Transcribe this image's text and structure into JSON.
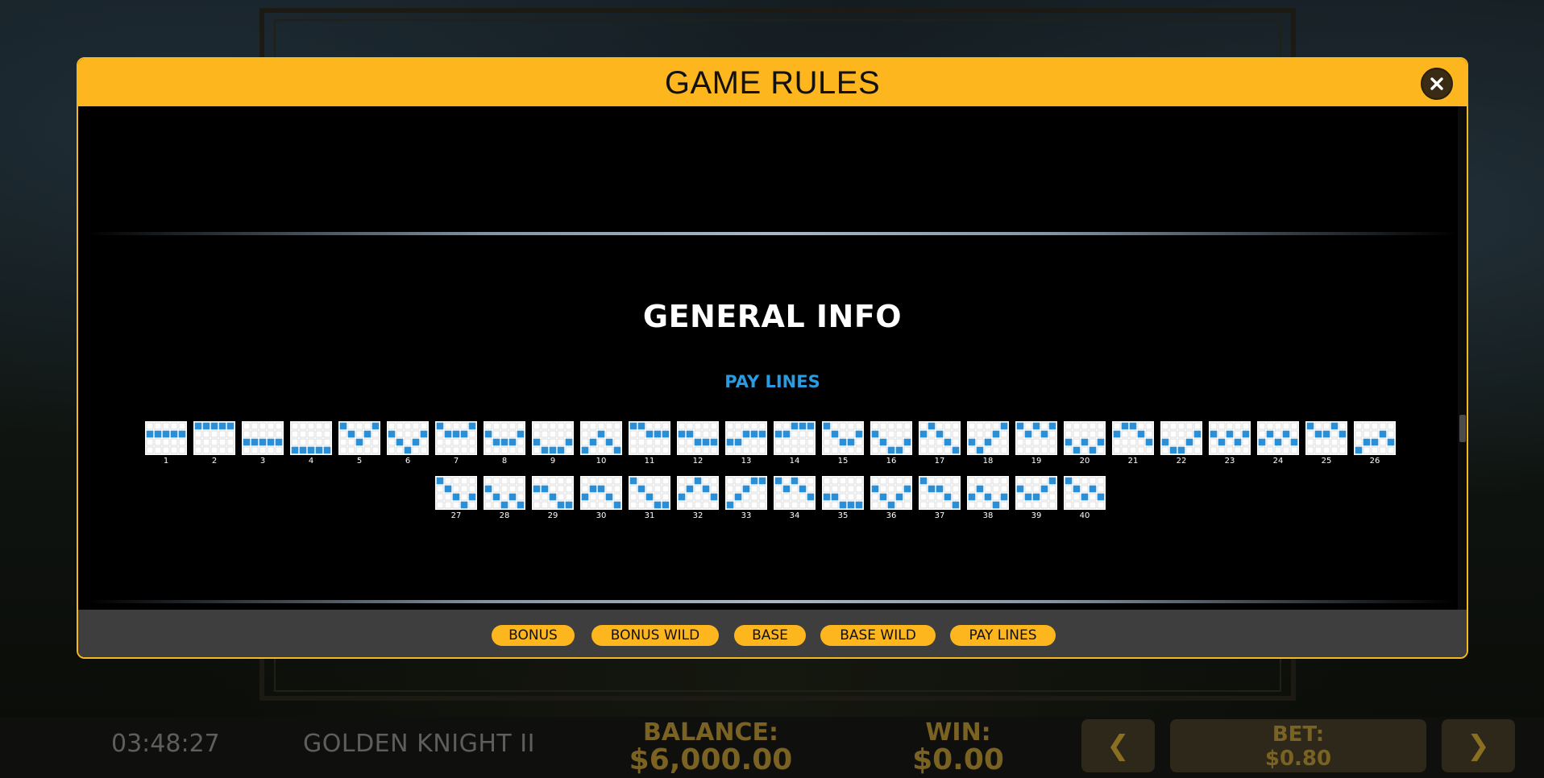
{
  "modal": {
    "title": "GAME RULES",
    "section_title": "GENERAL INFO",
    "subsection_title": "PAY LINES",
    "paylines": [
      {
        "number": "1",
        "rows": [
          1,
          1,
          1,
          1,
          1
        ]
      },
      {
        "number": "2",
        "rows": [
          0,
          0,
          0,
          0,
          0
        ]
      },
      {
        "number": "3",
        "rows": [
          2,
          2,
          2,
          2,
          2
        ]
      },
      {
        "number": "4",
        "rows": [
          3,
          3,
          3,
          3,
          3
        ]
      },
      {
        "number": "5",
        "rows": [
          0,
          1,
          2,
          1,
          0
        ]
      },
      {
        "number": "6",
        "rows": [
          1,
          2,
          3,
          2,
          1
        ]
      },
      {
        "number": "7",
        "rows": [
          0,
          1,
          1,
          1,
          0
        ]
      },
      {
        "number": "8",
        "rows": [
          1,
          2,
          2,
          2,
          1
        ]
      },
      {
        "number": "9",
        "rows": [
          2,
          3,
          3,
          3,
          2
        ]
      },
      {
        "number": "10",
        "rows": [
          3,
          2,
          1,
          2,
          3
        ]
      },
      {
        "number": "11",
        "rows": [
          0,
          0,
          1,
          1,
          1
        ]
      },
      {
        "number": "12",
        "rows": [
          1,
          1,
          2,
          2,
          2
        ]
      },
      {
        "number": "13",
        "rows": [
          2,
          2,
          1,
          1,
          1
        ]
      },
      {
        "number": "14",
        "rows": [
          1,
          1,
          0,
          0,
          0
        ]
      },
      {
        "number": "15",
        "rows": [
          0,
          1,
          2,
          2,
          1
        ]
      },
      {
        "number": "16",
        "rows": [
          1,
          2,
          3,
          3,
          2
        ]
      },
      {
        "number": "17",
        "rows": [
          1,
          0,
          1,
          2,
          3
        ]
      },
      {
        "number": "18",
        "rows": [
          2,
          3,
          2,
          1,
          0
        ]
      },
      {
        "number": "19",
        "rows": [
          0,
          1,
          0,
          1,
          0
        ]
      },
      {
        "number": "20",
        "rows": [
          2,
          3,
          2,
          3,
          2
        ]
      },
      {
        "number": "21",
        "rows": [
          1,
          0,
          0,
          1,
          2
        ]
      },
      {
        "number": "22",
        "rows": [
          2,
          3,
          3,
          2,
          1
        ]
      },
      {
        "number": "23",
        "rows": [
          1,
          2,
          1,
          2,
          1
        ]
      },
      {
        "number": "24",
        "rows": [
          2,
          1,
          2,
          1,
          2
        ]
      },
      {
        "number": "25",
        "rows": [
          0,
          1,
          1,
          0,
          1
        ]
      },
      {
        "number": "26",
        "rows": [
          3,
          2,
          2,
          1,
          2
        ]
      },
      {
        "number": "27",
        "rows": [
          0,
          1,
          2,
          3,
          2
        ]
      },
      {
        "number": "28",
        "rows": [
          1,
          2,
          3,
          2,
          3
        ]
      },
      {
        "number": "29",
        "rows": [
          1,
          1,
          2,
          3,
          3
        ]
      },
      {
        "number": "30",
        "rows": [
          2,
          1,
          1,
          2,
          3
        ]
      },
      {
        "number": "31",
        "rows": [
          0,
          1,
          2,
          3,
          3
        ]
      },
      {
        "number": "32",
        "rows": [
          2,
          1,
          0,
          1,
          2
        ]
      },
      {
        "number": "33",
        "rows": [
          3,
          2,
          1,
          0,
          0
        ]
      },
      {
        "number": "34",
        "rows": [
          0,
          1,
          0,
          1,
          2
        ]
      },
      {
        "number": "35",
        "rows": [
          2,
          2,
          3,
          3,
          3
        ]
      },
      {
        "number": "36",
        "rows": [
          1,
          2,
          3,
          2,
          1
        ]
      },
      {
        "number": "37",
        "rows": [
          0,
          1,
          1,
          2,
          3
        ]
      },
      {
        "number": "38",
        "rows": [
          2,
          1,
          2,
          3,
          2
        ]
      },
      {
        "number": "39",
        "rows": [
          1,
          2,
          2,
          1,
          0
        ]
      },
      {
        "number": "40",
        "rows": [
          0,
          1,
          2,
          1,
          2
        ]
      }
    ],
    "tabs": [
      {
        "label": "BONUS"
      },
      {
        "label": "BONUS WILD"
      },
      {
        "label": "BASE"
      },
      {
        "label": "BASE WILD"
      },
      {
        "label": "PAY LINES"
      }
    ]
  },
  "bottom_bar": {
    "clock": "03:48:27",
    "game_name": "GOLDEN KNIGHT II",
    "balance_label": "BALANCE:",
    "balance_value": "$6,000.00",
    "win_label": "WIN:",
    "win_value": "$0.00",
    "bet_label": "BET:",
    "bet_value": "$0.80",
    "prev_icon": "❮",
    "next_icon": "❯"
  },
  "colors": {
    "accent": "#fdb61e",
    "payline_fill": "#2a8fd6",
    "subtitle": "#2a9be0",
    "status_text": "#7a6222"
  },
  "icons": {
    "close": "close-icon",
    "prev": "chevron-left-icon",
    "next": "chevron-right-icon"
  }
}
